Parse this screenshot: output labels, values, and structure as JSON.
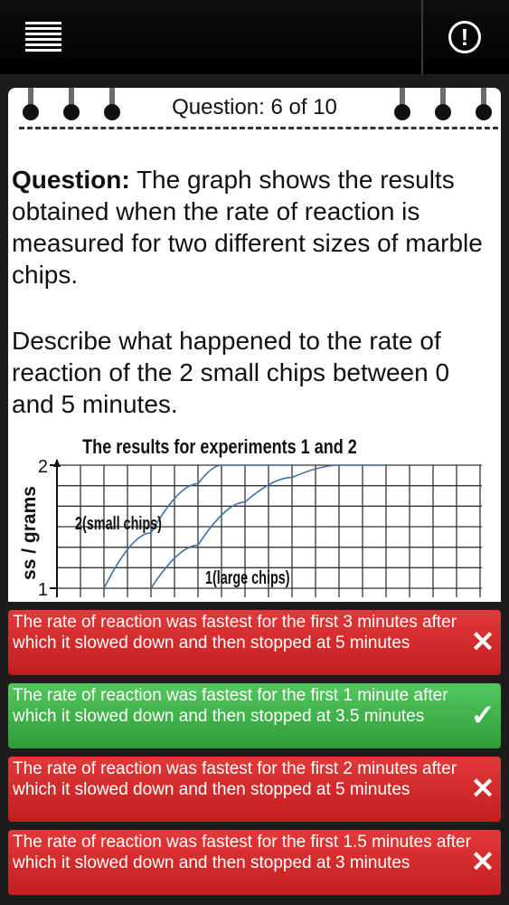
{
  "header": {
    "menu_icon": "hamburger-menu-icon",
    "alert_icon": "exclamation-circle-icon",
    "alert_glyph": "!"
  },
  "card": {
    "counter": "Question: 6 of 10",
    "question_label": "Question:",
    "question_text": "The graph shows the results obtained when the rate of reaction is measured for two different sizes of marble chips.",
    "instruction": "Describe what happened to the rate of reaction of the 2 small chips between 0 and 5 minutes."
  },
  "chart_data": {
    "type": "line",
    "title": "The results for experiments 1 and 2",
    "ylabel": "ss / grams",
    "y_ticks": [
      "2",
      "1"
    ],
    "series": [
      {
        "name": "2(small chips)",
        "x": [
          1.0,
          2.0,
          3.0,
          3.5,
          4.0,
          5.0
        ],
        "y": [
          1.0,
          1.45,
          1.85,
          2.0,
          2.0,
          2.0
        ]
      },
      {
        "name": "1(large chips)",
        "x": [
          2.0,
          3.0,
          4.0,
          5.0,
          6.0,
          7.0
        ],
        "y": [
          1.0,
          1.35,
          1.7,
          1.9,
          2.0,
          2.0
        ]
      }
    ],
    "grid": true,
    "color": "#3f6fa8"
  },
  "answers": [
    {
      "text": "The rate of reaction was fastest for the first 3 minutes after which it slowed down and then stopped at 5 minutes",
      "status": "wrong",
      "mark": "✕"
    },
    {
      "text": "The rate of reaction was fastest for the first 1 minute after which it slowed down and then stopped at 3.5 minutes",
      "status": "correct",
      "mark": "✓"
    },
    {
      "text": "The rate of reaction was fastest for the first 2 minutes after which it slowed down and then stopped at 5 minutes",
      "status": "wrong",
      "mark": "✕"
    },
    {
      "text": "The rate of reaction was fastest for the first 1.5 minutes after which it slowed down and then stopped at 3 minutes",
      "status": "wrong",
      "mark": "✕"
    }
  ],
  "colors": {
    "wrong": "#d42a2a",
    "correct": "#3fb449",
    "card": "#ffffff",
    "topbar": "#000000"
  }
}
